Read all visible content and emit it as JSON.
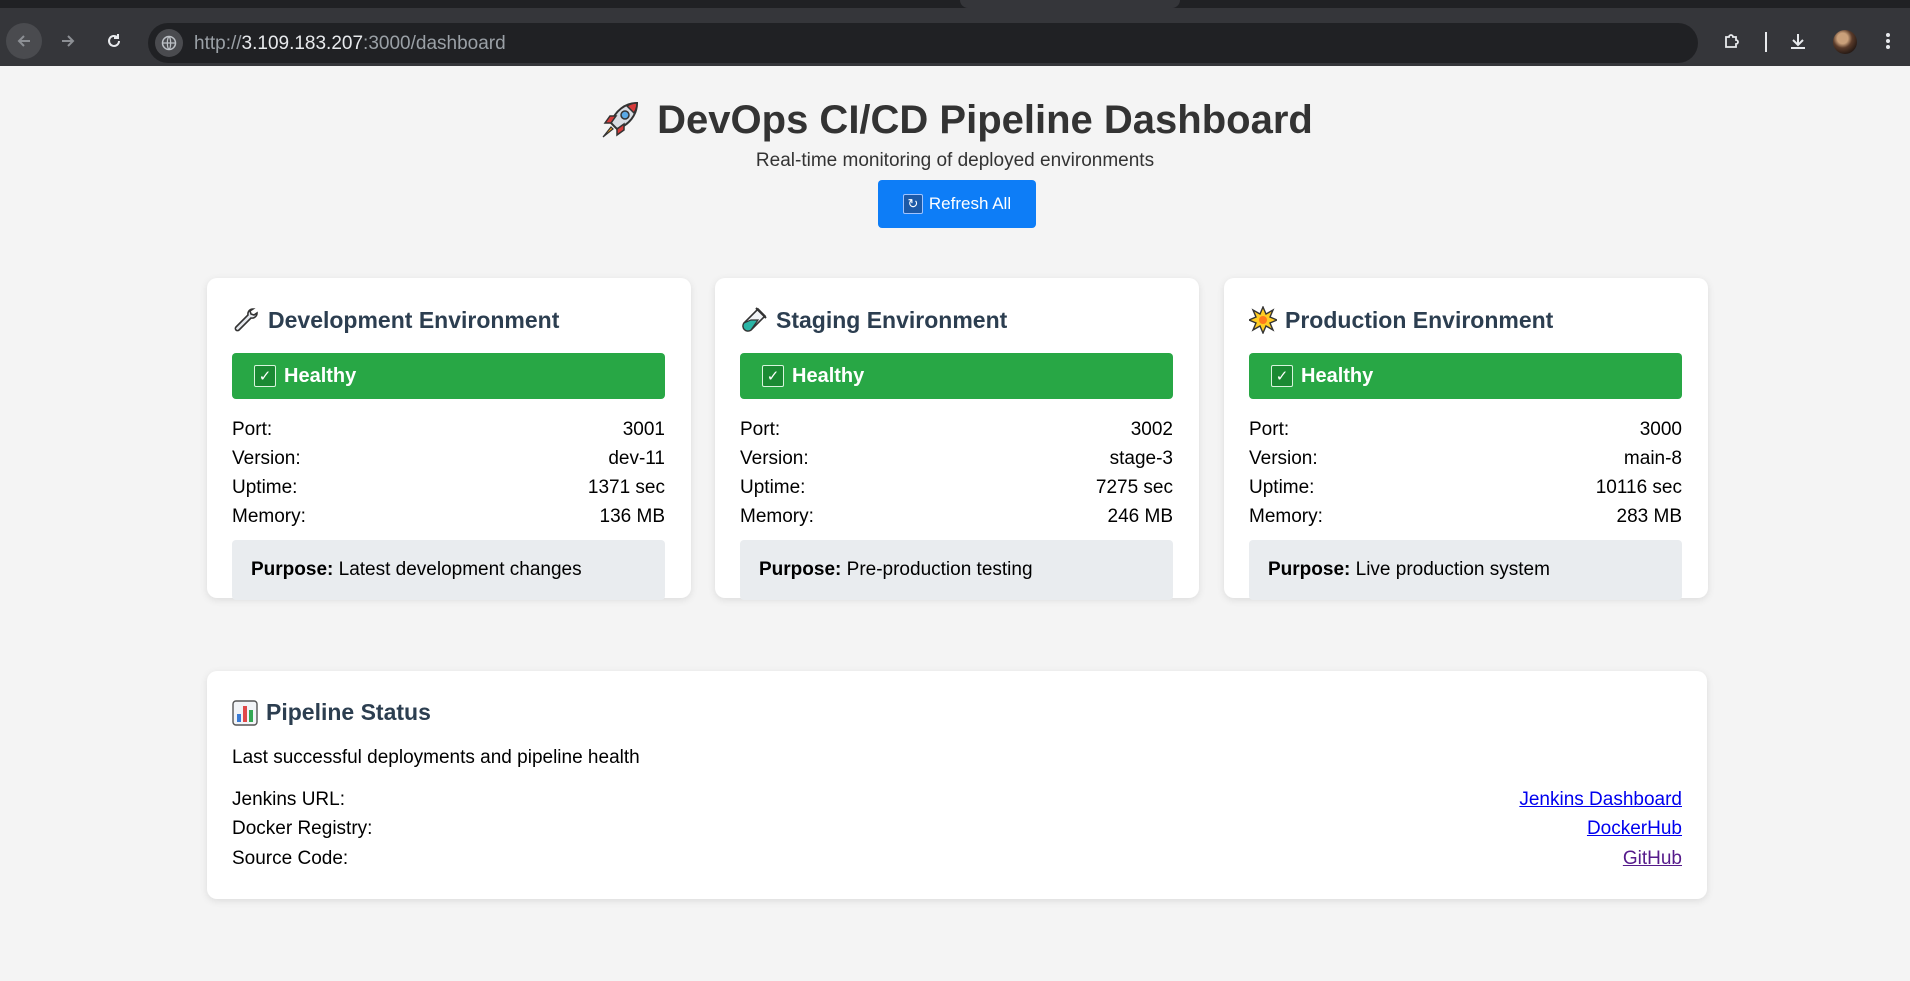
{
  "browser": {
    "url_prefix": "http://",
    "url_host": "3.109.183.207",
    "url_rest": ":3000/dashboard"
  },
  "header": {
    "title": "DevOps CI/CD Pipeline Dashboard",
    "subtitle": "Real-time monitoring of deployed environments",
    "refresh_label": "Refresh All"
  },
  "labels": {
    "port": "Port:",
    "version": "Version:",
    "uptime": "Uptime:",
    "memory": "Memory:",
    "purpose": "Purpose:"
  },
  "environments": [
    {
      "title": "Development Environment",
      "icon": "wrench-icon",
      "status": "Healthy",
      "port": "3001",
      "version": "dev-11",
      "uptime": "1371 sec",
      "memory": "136 MB",
      "purpose": "Latest development changes"
    },
    {
      "title": "Staging Environment",
      "icon": "test-tube-icon",
      "status": "Healthy",
      "port": "3002",
      "version": "stage-3",
      "uptime": "7275 sec",
      "memory": "246 MB",
      "purpose": "Pre-production testing"
    },
    {
      "title": "Production Environment",
      "icon": "explosion-star-icon",
      "status": "Healthy",
      "port": "3000",
      "version": "main-8",
      "uptime": "10116 sec",
      "memory": "283 MB",
      "purpose": "Live production system"
    }
  ],
  "pipeline": {
    "title": "Pipeline Status",
    "description": "Last successful deployments and pipeline health",
    "rows": [
      {
        "label": "Jenkins URL:",
        "link": "Jenkins Dashboard"
      },
      {
        "label": "Docker Registry:",
        "link": "DockerHub"
      },
      {
        "label": "Source Code:",
        "link": "GitHub"
      }
    ]
  },
  "colors": {
    "status_healthy": "#28a745",
    "refresh_button": "#0d7df7",
    "heading": "#2c3e50",
    "purpose_bg": "#e9ecef",
    "link": "#0000ee",
    "visited_link": "#551a8b"
  }
}
